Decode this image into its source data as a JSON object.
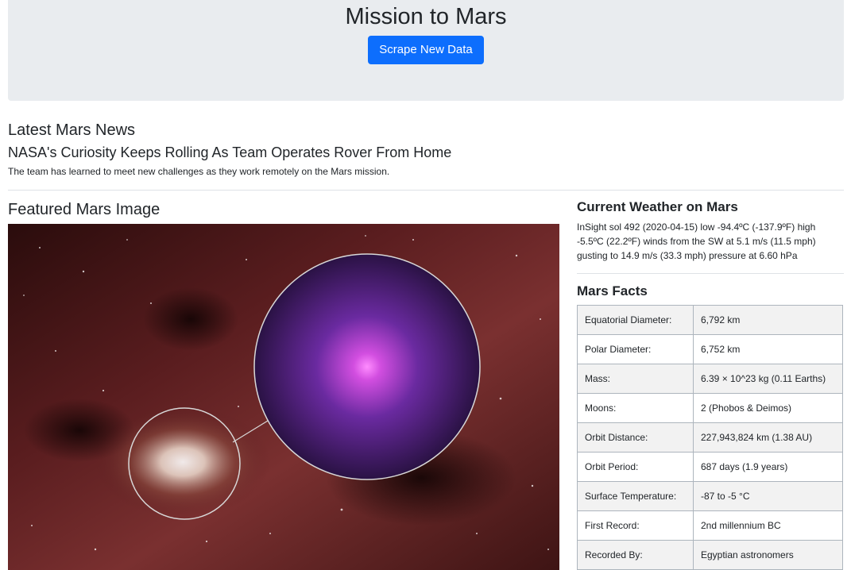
{
  "header": {
    "title": "Mission to Mars",
    "scrape_button_label": "Scrape New Data"
  },
  "news": {
    "section_title": "Latest Mars News",
    "headline": "NASA's Curiosity Keeps Rolling As Team Operates Rover From Home",
    "teaser": "The team has learned to meet new challenges as they work remotely on the Mars mission."
  },
  "featured": {
    "title": "Featured Mars Image"
  },
  "weather": {
    "title": "Current Weather on Mars",
    "text": "InSight sol 492 (2020-04-15) low -94.4ºC (-137.9ºF) high -5.5ºC (22.2ºF) winds from the SW at 5.1 m/s (11.5 mph) gusting to 14.9 m/s (33.3 mph) pressure at 6.60 hPa"
  },
  "facts": {
    "title": "Mars Facts",
    "rows": [
      {
        "label": "Equatorial Diameter:",
        "value": "6,792 km"
      },
      {
        "label": "Polar Diameter:",
        "value": "6,752 km"
      },
      {
        "label": "Mass:",
        "value": "6.39 × 10^23 kg (0.11 Earths)"
      },
      {
        "label": "Moons:",
        "value": "2 (Phobos & Deimos)"
      },
      {
        "label": "Orbit Distance:",
        "value": "227,943,824 km (1.38 AU)"
      },
      {
        "label": "Orbit Period:",
        "value": "687 days (1.9 years)"
      },
      {
        "label": "Surface Temperature:",
        "value": "-87 to -5 °C"
      },
      {
        "label": "First Record:",
        "value": "2nd millennium BC"
      },
      {
        "label": "Recorded By:",
        "value": "Egyptian astronomers"
      }
    ]
  }
}
